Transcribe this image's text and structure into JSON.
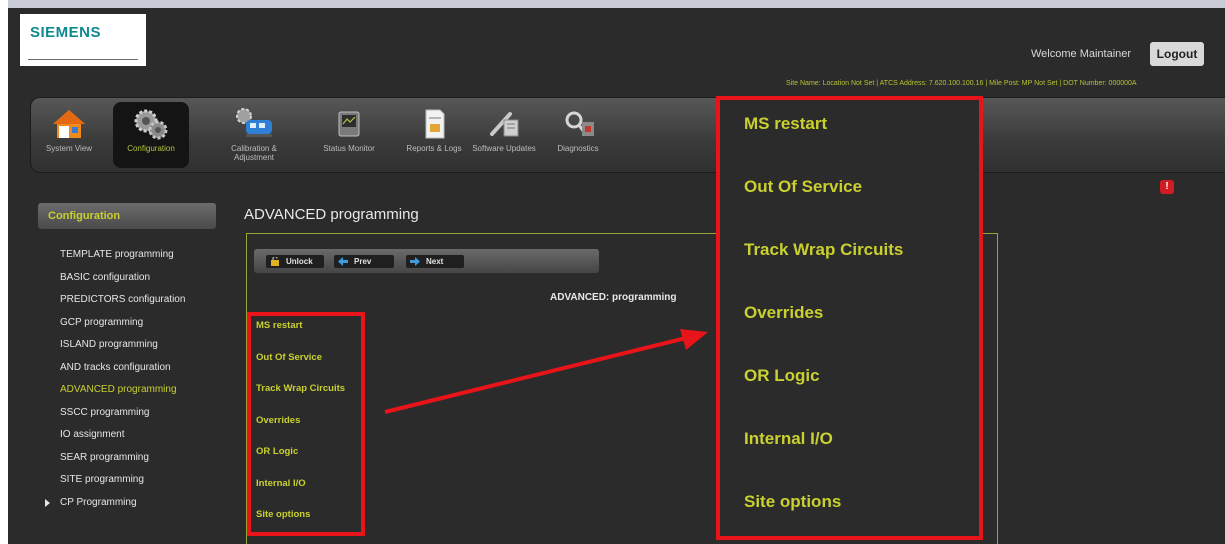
{
  "header": {
    "logo": "SIEMENS",
    "welcome": "Welcome Maintainer",
    "logout_label": "Logout",
    "site_info": "Site Name: Location Not Set | ATCS Address: 7.620.100.100.16 | Mile Post: MP Not Set | DOT Number: 000000A"
  },
  "nav": {
    "items": [
      {
        "label": "System View",
        "icon": "house-icon"
      },
      {
        "label": "Configuration",
        "icon": "gears-icon"
      },
      {
        "label": "Calibration & Adjustment",
        "icon": "train-gear-icon"
      },
      {
        "label": "Status Monitor",
        "icon": "monitor-icon"
      },
      {
        "label": "Reports & Logs",
        "icon": "report-icon"
      },
      {
        "label": "Software Updates",
        "icon": "software-update-icon"
      },
      {
        "label": "Diagnostics",
        "icon": "diagnostics-icon"
      }
    ]
  },
  "sidebar": {
    "header": "Configuration",
    "items": [
      "TEMPLATE programming",
      "BASIC configuration",
      "PREDICTORS configuration",
      "GCP programming",
      "ISLAND programming",
      "AND tracks configuration",
      "ADVANCED programming",
      "SSCC programming",
      "IO assignment",
      "SEAR programming",
      "SITE programming",
      "CP Programming"
    ],
    "current_index": 6
  },
  "main": {
    "title": "ADVANCED programming",
    "toolbar": {
      "unlock": "Unlock",
      "prev": "Prev",
      "next": "Next"
    },
    "section_label": "ADVANCED: programming",
    "links": [
      "MS restart",
      "Out Of Service",
      "Track Wrap Circuits",
      "Overrides",
      "OR Logic",
      "Internal I/O",
      "Site options"
    ]
  },
  "zoom": {
    "items": [
      "MS restart",
      "Out Of Service",
      "Track Wrap Circuits",
      "Overrides",
      "OR Logic",
      "Internal I/O",
      "Site options"
    ]
  },
  "alert": {
    "label": "!"
  },
  "colors": {
    "accent": "#c9d02f",
    "highlight_red": "#e8141a",
    "background": "#2b2b2b"
  }
}
